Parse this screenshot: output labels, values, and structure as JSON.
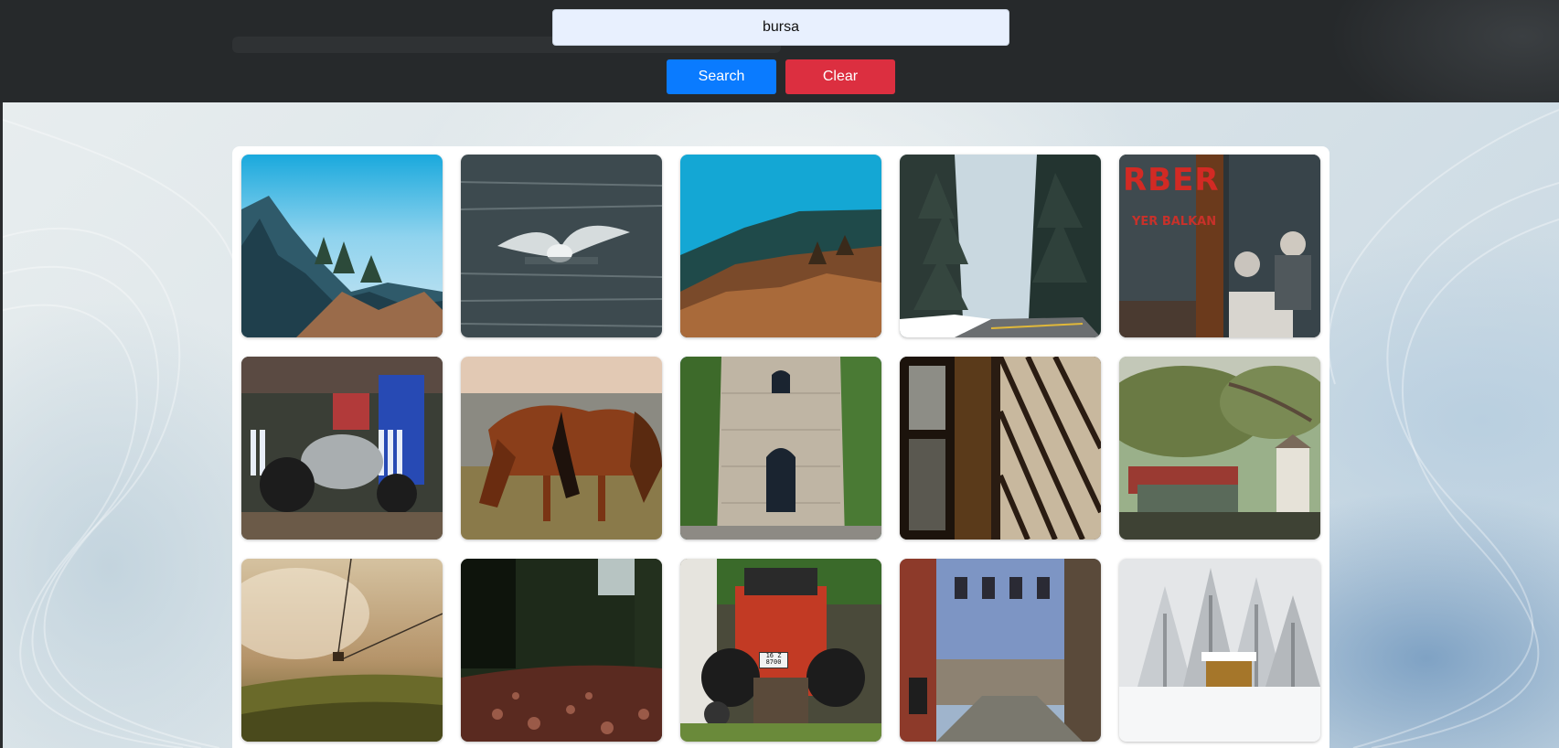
{
  "search": {
    "value": "bursa",
    "placeholder": ""
  },
  "buttons": {
    "search_label": "Search",
    "clear_label": "Clear"
  },
  "colors": {
    "search_button": "#0a7bff",
    "clear_button": "#dc2f40",
    "header_bg": "#26292b",
    "input_bg": "#e8f0fe"
  },
  "gallery": {
    "images": [
      {
        "subject": "mountain-panorama",
        "caption_text": ""
      },
      {
        "subject": "seagull-on-water",
        "caption_text": ""
      },
      {
        "subject": "forested-mountain-slope",
        "caption_text": ""
      },
      {
        "subject": "snowy-forest-road",
        "caption_text": ""
      },
      {
        "subject": "barber-shop",
        "caption_text": "RBER",
        "caption_sub": "YER BALKAN"
      },
      {
        "subject": "old-tractor",
        "caption_text": ""
      },
      {
        "subject": "grazing-horses",
        "caption_text": ""
      },
      {
        "subject": "stone-clock-tower",
        "caption_text": ""
      },
      {
        "subject": "shadowed-window",
        "caption_text": ""
      },
      {
        "subject": "village-square-tree",
        "caption_text": ""
      },
      {
        "subject": "cable-car-fog",
        "caption_text": ""
      },
      {
        "subject": "forest-leaf-path",
        "caption_text": ""
      },
      {
        "subject": "red-tractor",
        "caption_text": "",
        "plate_text": "16 Z 8700"
      },
      {
        "subject": "ottoman-houses-street",
        "caption_text": ""
      },
      {
        "subject": "snow-cabin",
        "caption_text": ""
      }
    ]
  }
}
